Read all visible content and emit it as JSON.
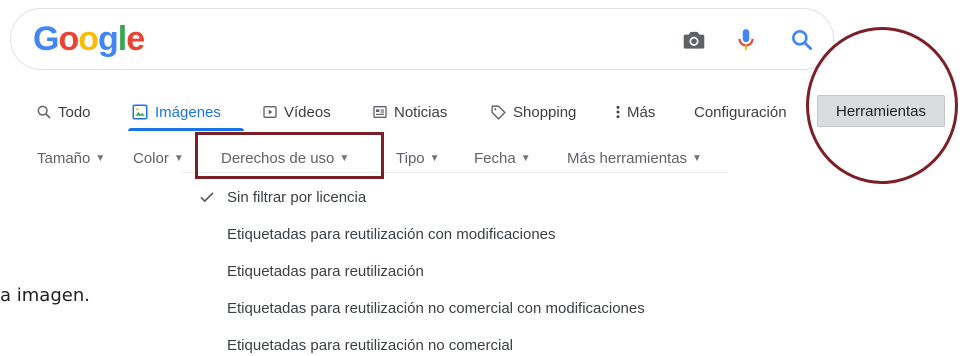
{
  "logo": {
    "letters": [
      "G",
      "o",
      "o",
      "g",
      "l",
      "e"
    ]
  },
  "search": {
    "icons": [
      "camera-icon",
      "mic-icon",
      "search-icon"
    ],
    "colors": {
      "mic_blue": "#4285f4",
      "mic_red": "#ea4335",
      "search_blue": "#4285f4",
      "camera": "#5f6368"
    }
  },
  "tabs": [
    {
      "label": "Todo",
      "icon": "search-icon"
    },
    {
      "label": "Imágenes",
      "icon": "image-icon",
      "active": true
    },
    {
      "label": "Vídeos",
      "icon": "play-icon"
    },
    {
      "label": "Noticias",
      "icon": "news-icon"
    },
    {
      "label": "Shopping",
      "icon": "tag-icon"
    },
    {
      "label": "Más",
      "icon": "more-vert-icon"
    },
    {
      "label": "Configuración"
    }
  ],
  "tools": {
    "label": "Herramientas"
  },
  "filters": [
    {
      "label": "Tamaño"
    },
    {
      "label": "Color"
    },
    {
      "label": "Derechos de uso"
    },
    {
      "label": "Tipo"
    },
    {
      "label": "Fecha"
    },
    {
      "label": "Más herramientas"
    }
  ],
  "dropdown": {
    "items": [
      {
        "label": "Sin filtrar por licencia",
        "checked": true
      },
      {
        "label": "Etiquetadas para reutilización con modificaciones"
      },
      {
        "label": "Etiquetadas para reutilización"
      },
      {
        "label": "Etiquetadas para reutilización no comercial con modificaciones"
      },
      {
        "label": "Etiquetadas para reutilización no comercial"
      }
    ]
  },
  "background": {
    "partial_text": "a imagen."
  },
  "colors": {
    "accent": "#1a73e8",
    "highlight": "#7b1f28"
  }
}
